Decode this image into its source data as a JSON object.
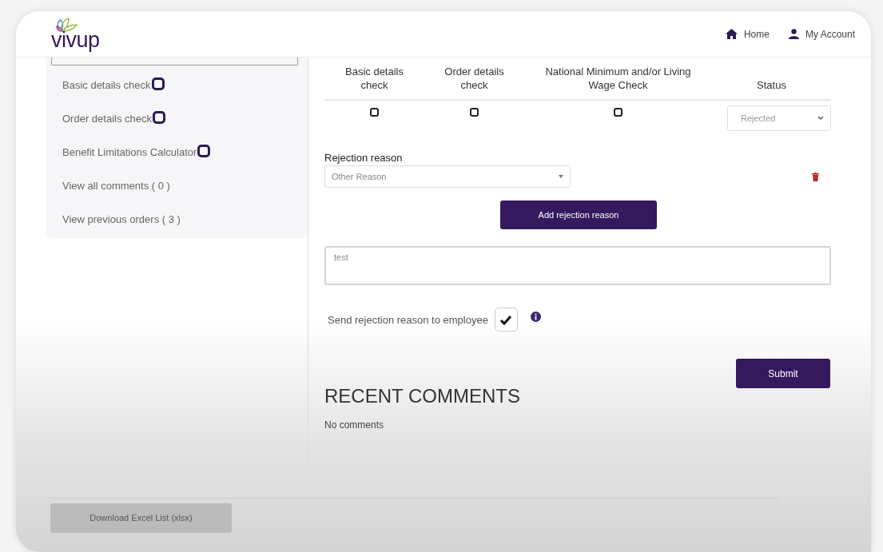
{
  "header": {
    "logo": "vivup",
    "nav": [
      {
        "label": "Home",
        "kind": "home"
      },
      {
        "label": "My Account",
        "kind": "account"
      }
    ]
  },
  "sidebar": {
    "items": [
      {
        "label": "Basic details check",
        "kind": "checkbox",
        "checked": false
      },
      {
        "label": "Order details check",
        "kind": "checkbox",
        "checked": false
      },
      {
        "label": "Benefit Limitations Calculator",
        "kind": "checkbox",
        "checked": false
      },
      {
        "label": "View all comments ( 0 )",
        "kind": "link"
      },
      {
        "label": "View previous orders ( 3 )",
        "kind": "link"
      }
    ]
  },
  "checks_table": {
    "columns": [
      "Basic details check",
      "Order details check",
      "National Minimum and/or Living Wage Check",
      "Status"
    ],
    "row": {
      "checks": [
        {
          "checked": false
        },
        {
          "checked": false
        },
        {
          "checked": false
        }
      ],
      "status": "Rejected"
    }
  },
  "rejection": {
    "label": "Rejection reason",
    "reason": "Other Reason",
    "add_button": "Add rejection reason",
    "note": "test"
  },
  "send_to_employee": {
    "label": "Send rejection reason to employee",
    "checked": true
  },
  "submit": "Submit",
  "recent_comments": {
    "title": "RECENT COMMENTS",
    "text": "No comments"
  },
  "download": {
    "label": "Download Excel List (xlsx)",
    "disabled": true
  }
}
